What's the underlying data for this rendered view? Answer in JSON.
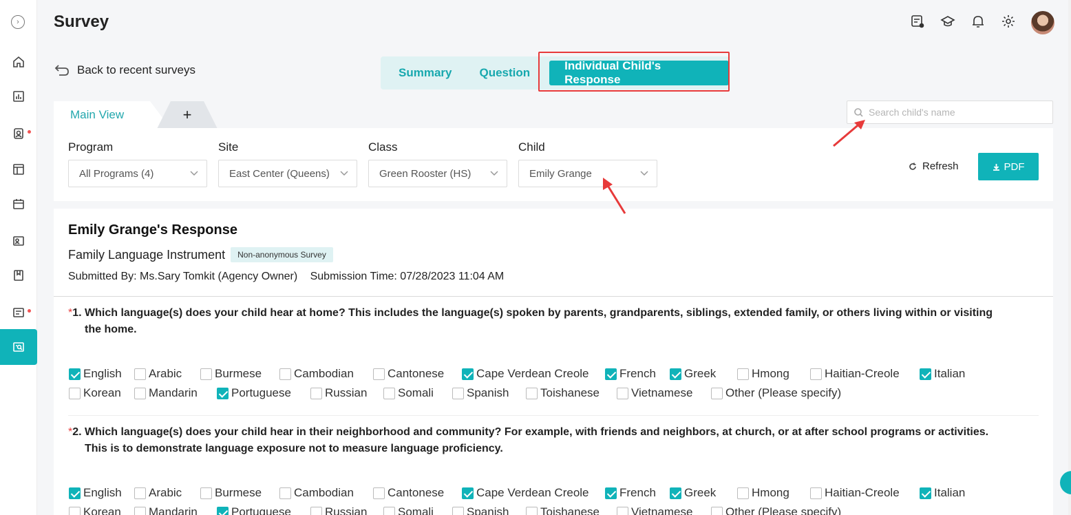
{
  "header": {
    "title": "Survey"
  },
  "back_link": "Back to recent surveys",
  "tabs": [
    {
      "label": "Summary"
    },
    {
      "label": "Question"
    },
    {
      "label": "Individual Child's Response"
    }
  ],
  "view_tabs": {
    "main": "Main View",
    "add": "+"
  },
  "search": {
    "placeholder": "Search child's name"
  },
  "filters": {
    "program": {
      "label": "Program",
      "value": "All Programs (4)"
    },
    "site": {
      "label": "Site",
      "value": "East Center (Queens)"
    },
    "class": {
      "label": "Class",
      "value": "Green Rooster (HS)"
    },
    "child": {
      "label": "Child",
      "value": "Emily Grange"
    }
  },
  "actions": {
    "refresh": "Refresh",
    "pdf": "PDF"
  },
  "response": {
    "title": "Emily Grange's Response",
    "survey_name": "Family Language Instrument",
    "badge": "Non-anonymous Survey",
    "submitted_by": "Submitted By: Ms.Sary Tomkit (Agency Owner)",
    "submission_time": "Submission Time: 07/28/2023 11:04 AM"
  },
  "questions": [
    {
      "num": "1.",
      "text": "Which language(s) does your child hear at home? This includes the language(s) spoken by parents, grandparents, siblings, extended family, or others living within or visiting the home.",
      "options": [
        {
          "label": "English",
          "checked": true
        },
        {
          "label": "Arabic",
          "checked": false
        },
        {
          "label": "Burmese",
          "checked": false
        },
        {
          "label": "Cambodian",
          "checked": false
        },
        {
          "label": "Cantonese",
          "checked": false
        },
        {
          "label": "Cape Verdean Creole",
          "checked": true
        },
        {
          "label": "French",
          "checked": true
        },
        {
          "label": "Greek",
          "checked": true
        },
        {
          "label": "Hmong",
          "checked": false
        },
        {
          "label": "Haitian-Creole",
          "checked": false
        },
        {
          "label": "Italian",
          "checked": true
        },
        {
          "label": "Korean",
          "checked": false
        },
        {
          "label": "Mandarin",
          "checked": false
        },
        {
          "label": "Portuguese",
          "checked": true
        },
        {
          "label": "Russian",
          "checked": false
        },
        {
          "label": "Somali",
          "checked": false
        },
        {
          "label": "Spanish",
          "checked": false
        },
        {
          "label": "Toishanese",
          "checked": false
        },
        {
          "label": "Vietnamese",
          "checked": false
        },
        {
          "label": "Other (Please specify)",
          "checked": false
        }
      ]
    },
    {
      "num": "2.",
      "text": "Which language(s) does your child hear in their neighborhood and community? For example, with friends and neighbors, at church, or at after school programs or activities. This is to demonstrate language exposure not to measure language proficiency.",
      "options": [
        {
          "label": "English",
          "checked": true
        },
        {
          "label": "Arabic",
          "checked": false
        },
        {
          "label": "Burmese",
          "checked": false
        },
        {
          "label": "Cambodian",
          "checked": false
        },
        {
          "label": "Cantonese",
          "checked": false
        },
        {
          "label": "Cape Verdean Creole",
          "checked": true
        },
        {
          "label": "French",
          "checked": true
        },
        {
          "label": "Greek",
          "checked": true
        },
        {
          "label": "Hmong",
          "checked": false
        },
        {
          "label": "Haitian-Creole",
          "checked": false
        },
        {
          "label": "Italian",
          "checked": true
        },
        {
          "label": "Korean",
          "checked": false
        },
        {
          "label": "Mandarin",
          "checked": false
        },
        {
          "label": "Portuguese",
          "checked": true
        },
        {
          "label": "Russian",
          "checked": false
        },
        {
          "label": "Somali",
          "checked": false
        },
        {
          "label": "Spanish",
          "checked": false
        },
        {
          "label": "Toishanese",
          "checked": false
        },
        {
          "label": "Vietnamese",
          "checked": false
        },
        {
          "label": "Other (Please specify)",
          "checked": false
        }
      ]
    }
  ],
  "colors": {
    "accent": "#10b3b9",
    "highlight": "#e73a3a",
    "required": "#e73a3a"
  },
  "icons": {
    "sidebar": [
      "expand-icon",
      "home-icon",
      "chart-icon",
      "profile-icon",
      "layout-icon",
      "calendar-icon",
      "id-card-icon",
      "book-icon",
      "survey-list-icon",
      "survey-active-icon"
    ],
    "top": [
      "feedback-icon",
      "graduation-cap-icon",
      "bell-icon",
      "gear-icon",
      "avatar"
    ]
  }
}
